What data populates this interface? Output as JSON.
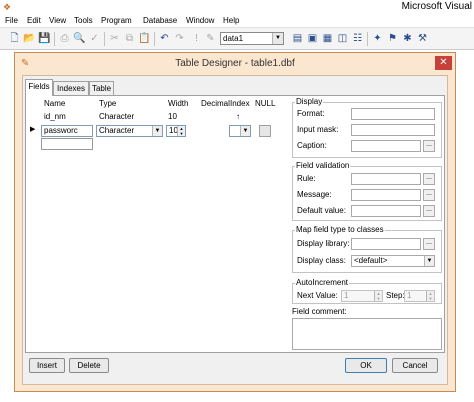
{
  "app": {
    "title": "Microsoft Visual",
    "menu": [
      "File",
      "Edit",
      "View",
      "Tools",
      "Program",
      "Database",
      "Window",
      "Help"
    ],
    "toolbar_combo_value": "data1"
  },
  "dialog": {
    "title": "Table Designer - table1.dbf",
    "close_label": "✕",
    "tabs": [
      "Fields",
      "Indexes",
      "Table"
    ],
    "columns": {
      "name": "Name",
      "type": "Type",
      "width": "Width",
      "decimal": "Decimal",
      "index": "Index",
      "null": "NULL"
    },
    "rows": [
      {
        "name": "id_nm",
        "type": "Character",
        "width": "10",
        "index_symbol": "↑"
      },
      {
        "name": "passworc",
        "type": "Character",
        "width": "10",
        "index_symbol": ""
      }
    ],
    "display": {
      "title": "Display",
      "format_label": "Format:",
      "input_mask_label": "Input mask:",
      "caption_label": "Caption:"
    },
    "field_validation": {
      "title": "Field validation",
      "rule_label": "Rule:",
      "message_label": "Message:",
      "default_value_label": "Default value:"
    },
    "map_field": {
      "title": "Map field type to classes",
      "display_library_label": "Display library:",
      "display_class_label": "Display class:",
      "display_class_value": "<default>"
    },
    "autoincrement": {
      "title": "AutoIncrement",
      "next_value_label": "Next Value:",
      "next_value": "1",
      "step_label": "Step:",
      "step_value": "1"
    },
    "field_comment_label": "Field comment:",
    "buttons": {
      "insert": "Insert",
      "delete": "Delete",
      "ok": "OK",
      "cancel": "Cancel"
    }
  },
  "icons": [
    "new-file-icon",
    "open-folder-icon",
    "save-icon",
    "print-icon",
    "print-preview-icon",
    "spell-check-icon",
    "cut-icon",
    "copy-icon",
    "paste-icon",
    "undo-icon",
    "redo-icon",
    "run-icon",
    "modify-icon",
    "data-session-icon",
    "command-window-icon",
    "properties-icon",
    "class-browser-icon",
    "document-view-icon",
    "toolbox-icon",
    "task-pane-icon",
    "code-references-icon"
  ]
}
